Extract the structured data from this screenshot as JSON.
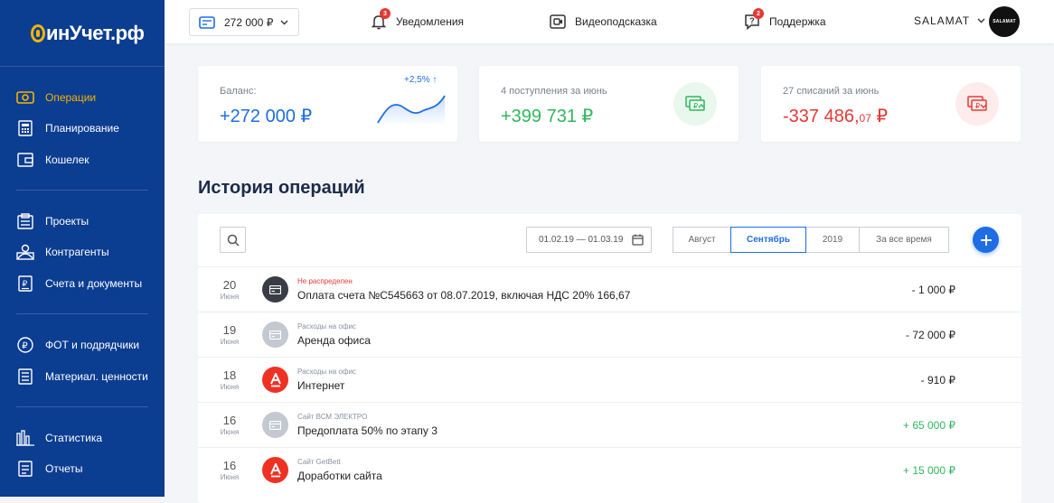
{
  "sidebar": {
    "logo": "инУчет.рф",
    "items": [
      {
        "label": "Операции",
        "icon": "operations-icon",
        "active": true
      },
      {
        "label": "Планирование",
        "icon": "calculator-icon"
      },
      {
        "label": "Кошелек",
        "icon": "wallet-icon"
      },
      {
        "label": "Проекты",
        "icon": "projects-icon"
      },
      {
        "label": "Контрагенты",
        "icon": "contacts-icon"
      },
      {
        "label": "Счета и документы",
        "icon": "document-icon"
      },
      {
        "label": "ФОТ и подрядчики",
        "icon": "ruble-icon"
      },
      {
        "label": "Материал. ценности",
        "icon": "list-icon"
      },
      {
        "label": "Статистика",
        "icon": "stats-icon"
      },
      {
        "label": "Отчеты",
        "icon": "report-icon"
      }
    ]
  },
  "header": {
    "wallet_amount": "272 000 ₽",
    "notifications_label": "Уведомления",
    "notifications_count": "3",
    "video_label": "Видеоподсказка",
    "support_label": "Поддержка",
    "support_count": "2",
    "user_name": "SALAMAT",
    "avatar_text": "SALAMAT"
  },
  "cards": {
    "balance": {
      "label": "Баланс:",
      "value": "+272 000 ₽",
      "change": "+2,5% ↑"
    },
    "income": {
      "label": "4 поступления за июнь",
      "value": "+399 731 ₽"
    },
    "expense": {
      "label": "27 списаний за июнь",
      "value_main": "-337 486,",
      "value_cents": "07",
      "value_currency": " ₽"
    }
  },
  "history": {
    "title": "История операций",
    "date_range": "01.02.19 — 01.03.19",
    "periods": [
      "Август",
      "Сентябрь",
      "2019",
      "За все время"
    ],
    "selected_period": "Сентябрь",
    "rows": [
      {
        "day": "20",
        "month": "Июня",
        "category": "Не распределен",
        "title": "Оплата счета №С545663 от 08.07.2019, включая НДС 20% 166,67",
        "amount": "- 1 000 ₽"
      },
      {
        "day": "19",
        "month": "Июня",
        "category": "Расходы на офис",
        "title": "Аренда офиса",
        "amount": "- 72 000 ₽"
      },
      {
        "day": "18",
        "month": "Июня",
        "category": "Расходы на офис",
        "title": "Интернет",
        "amount": "- 910 ₽"
      },
      {
        "day": "16",
        "month": "Июня",
        "category": "Сайт ВСМ ЭЛЕКТРО",
        "title": "Предоплата 50% по этапу 3",
        "amount": "+ 65 000 ₽"
      },
      {
        "day": "16",
        "month": "Июня",
        "category": "Сайт GetBett",
        "title": "Доработки сайта",
        "amount": "+ 15 000 ₽"
      }
    ]
  },
  "colors": {
    "sidebar_bg": "#0b3d91",
    "accent_blue": "#1e6de5",
    "active_yellow": "#f4b400",
    "positive_green": "#2eb85c",
    "negative_red": "#e53935"
  }
}
